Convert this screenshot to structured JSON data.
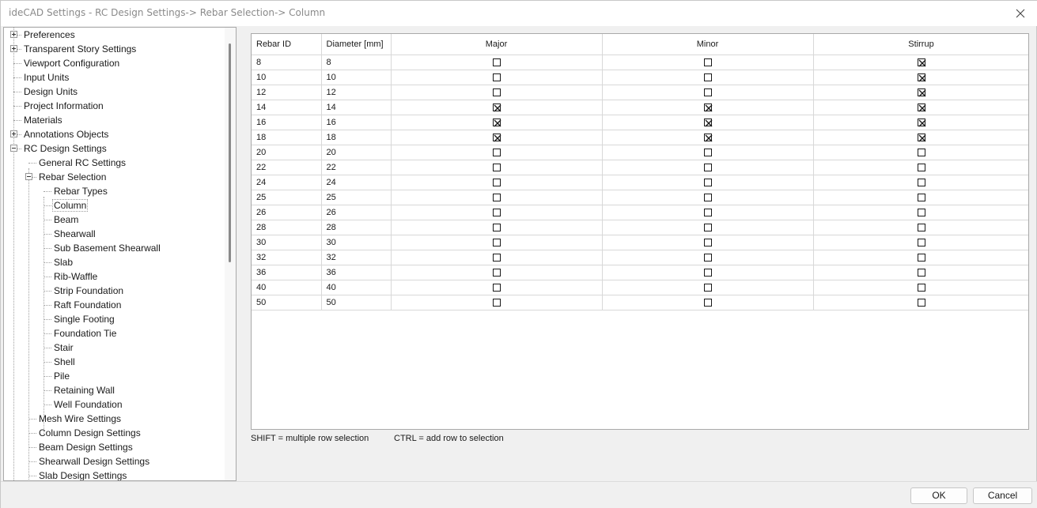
{
  "window": {
    "title": "ideCAD Settings - RC Design Settings-> Rebar Selection-> Column"
  },
  "tree": {
    "items": [
      {
        "label": "Preferences",
        "expander": "+"
      },
      {
        "label": "Transparent Story Settings",
        "expander": "+"
      },
      {
        "label": "Viewport Configuration",
        "expander": ""
      },
      {
        "label": "Input Units",
        "expander": ""
      },
      {
        "label": "Design Units",
        "expander": ""
      },
      {
        "label": "Project Information",
        "expander": ""
      },
      {
        "label": "Materials",
        "expander": ""
      },
      {
        "label": "Annotations Objects",
        "expander": "+"
      },
      {
        "label": "RC Design Settings",
        "expander": "-"
      },
      {
        "label": "General RC Settings",
        "expander": ""
      },
      {
        "label": "Rebar Selection",
        "expander": "-"
      },
      {
        "label": "Rebar Types",
        "expander": ""
      },
      {
        "label": "Column",
        "expander": "",
        "selected": true
      },
      {
        "label": "Beam",
        "expander": ""
      },
      {
        "label": "Shearwall",
        "expander": ""
      },
      {
        "label": "Sub Basement Shearwall",
        "expander": ""
      },
      {
        "label": "Slab",
        "expander": ""
      },
      {
        "label": "Rib-Waffle",
        "expander": ""
      },
      {
        "label": "Strip Foundation",
        "expander": ""
      },
      {
        "label": "Raft Foundation",
        "expander": ""
      },
      {
        "label": "Single Footing",
        "expander": ""
      },
      {
        "label": "Foundation Tie",
        "expander": ""
      },
      {
        "label": "Stair",
        "expander": ""
      },
      {
        "label": "Shell",
        "expander": ""
      },
      {
        "label": "Pile",
        "expander": ""
      },
      {
        "label": "Retaining Wall",
        "expander": ""
      },
      {
        "label": "Well Foundation",
        "expander": ""
      },
      {
        "label": "Mesh Wire Settings",
        "expander": ""
      },
      {
        "label": "Column Design Settings",
        "expander": ""
      },
      {
        "label": "Beam Design Settings",
        "expander": ""
      },
      {
        "label": "Shearwall Design Settings",
        "expander": ""
      },
      {
        "label": "Slab Design Settings",
        "expander": ""
      }
    ]
  },
  "grid": {
    "columns": [
      "Rebar ID",
      "Diameter [mm]",
      "Major",
      "Minor",
      "Stirrup"
    ],
    "rows": [
      {
        "id": "8",
        "diameter": "8",
        "major": false,
        "minor": false,
        "stirrup": true
      },
      {
        "id": "10",
        "diameter": "10",
        "major": false,
        "minor": false,
        "stirrup": true
      },
      {
        "id": "12",
        "diameter": "12",
        "major": false,
        "minor": false,
        "stirrup": true
      },
      {
        "id": "14",
        "diameter": "14",
        "major": true,
        "minor": true,
        "stirrup": true
      },
      {
        "id": "16",
        "diameter": "16",
        "major": true,
        "minor": true,
        "stirrup": true
      },
      {
        "id": "18",
        "diameter": "18",
        "major": true,
        "minor": true,
        "stirrup": true
      },
      {
        "id": "20",
        "diameter": "20",
        "major": false,
        "minor": false,
        "stirrup": false
      },
      {
        "id": "22",
        "diameter": "22",
        "major": false,
        "minor": false,
        "stirrup": false
      },
      {
        "id": "24",
        "diameter": "24",
        "major": false,
        "minor": false,
        "stirrup": false
      },
      {
        "id": "25",
        "diameter": "25",
        "major": false,
        "minor": false,
        "stirrup": false
      },
      {
        "id": "26",
        "diameter": "26",
        "major": false,
        "minor": false,
        "stirrup": false
      },
      {
        "id": "28",
        "diameter": "28",
        "major": false,
        "minor": false,
        "stirrup": false
      },
      {
        "id": "30",
        "diameter": "30",
        "major": false,
        "minor": false,
        "stirrup": false
      },
      {
        "id": "32",
        "diameter": "32",
        "major": false,
        "minor": false,
        "stirrup": false
      },
      {
        "id": "36",
        "diameter": "36",
        "major": false,
        "minor": false,
        "stirrup": false
      },
      {
        "id": "40",
        "diameter": "40",
        "major": false,
        "minor": false,
        "stirrup": false
      },
      {
        "id": "50",
        "diameter": "50",
        "major": false,
        "minor": false,
        "stirrup": false
      }
    ]
  },
  "hints": {
    "shift": "SHIFT = multiple row selection",
    "ctrl": "CTRL = add row to selection"
  },
  "buttons": {
    "ok": "OK",
    "cancel": "Cancel"
  },
  "icons": {
    "close": "close-icon",
    "expander": "tree-expander-icon"
  }
}
